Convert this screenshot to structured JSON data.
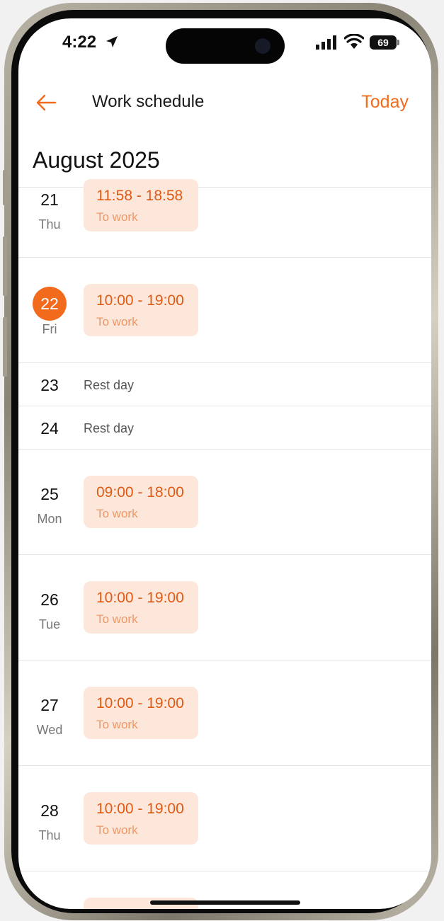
{
  "status_bar": {
    "time": "4:22",
    "battery": "69",
    "icons": [
      "location-arrow-icon",
      "signal-icon",
      "wifi-icon",
      "battery-icon"
    ]
  },
  "header": {
    "title": "Work schedule",
    "today_label": "Today",
    "back_icon": "back-arrow-icon"
  },
  "month_label": "August 2025",
  "colors": {
    "accent": "#f26b1d",
    "shift_bg": "#fde7db",
    "shift_time": "#e05a14",
    "shift_label": "#ec9869"
  },
  "days": [
    {
      "num": "21",
      "weekday": "Thu",
      "time": "11:58 - 18:58",
      "label": "To work"
    },
    {
      "num": "22",
      "weekday": "Fri",
      "time": "10:00 - 19:00",
      "label": "To work",
      "today": true
    },
    {
      "num": "23",
      "rest": "Rest day"
    },
    {
      "num": "24",
      "rest": "Rest day"
    },
    {
      "num": "25",
      "weekday": "Mon",
      "time": "09:00 - 18:00",
      "label": "To work"
    },
    {
      "num": "26",
      "weekday": "Tue",
      "time": "10:00 - 19:00",
      "label": "To work"
    },
    {
      "num": "27",
      "weekday": "Wed",
      "time": "10:00 - 19:00",
      "label": "To work"
    },
    {
      "num": "28",
      "weekday": "Thu",
      "time": "10:00 - 19:00",
      "label": "To work"
    }
  ]
}
